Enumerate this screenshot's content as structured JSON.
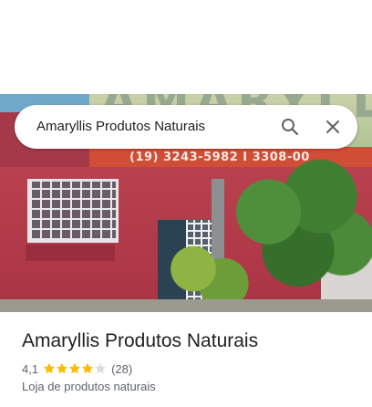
{
  "search": {
    "query": "Amaryllis Produtos Naturais"
  },
  "photo": {
    "sign_name": "AMARYLLIS",
    "sign_phone": "(19) 3243-5982 I 3308-00"
  },
  "place": {
    "title": "Amaryllis Produtos Naturais",
    "rating": "4,1",
    "rating_value": 4.1,
    "stars_max": 5,
    "review_count": "(28)",
    "category": "Loja de produtos naturais"
  },
  "icons": {
    "search": "search-icon",
    "close": "close-icon",
    "star": "star-icon"
  },
  "colors": {
    "star": "#fbbc04",
    "star_empty": "#dadce0",
    "icon": "#5f6368",
    "title": "#202124",
    "secondary": "#5f6368"
  }
}
